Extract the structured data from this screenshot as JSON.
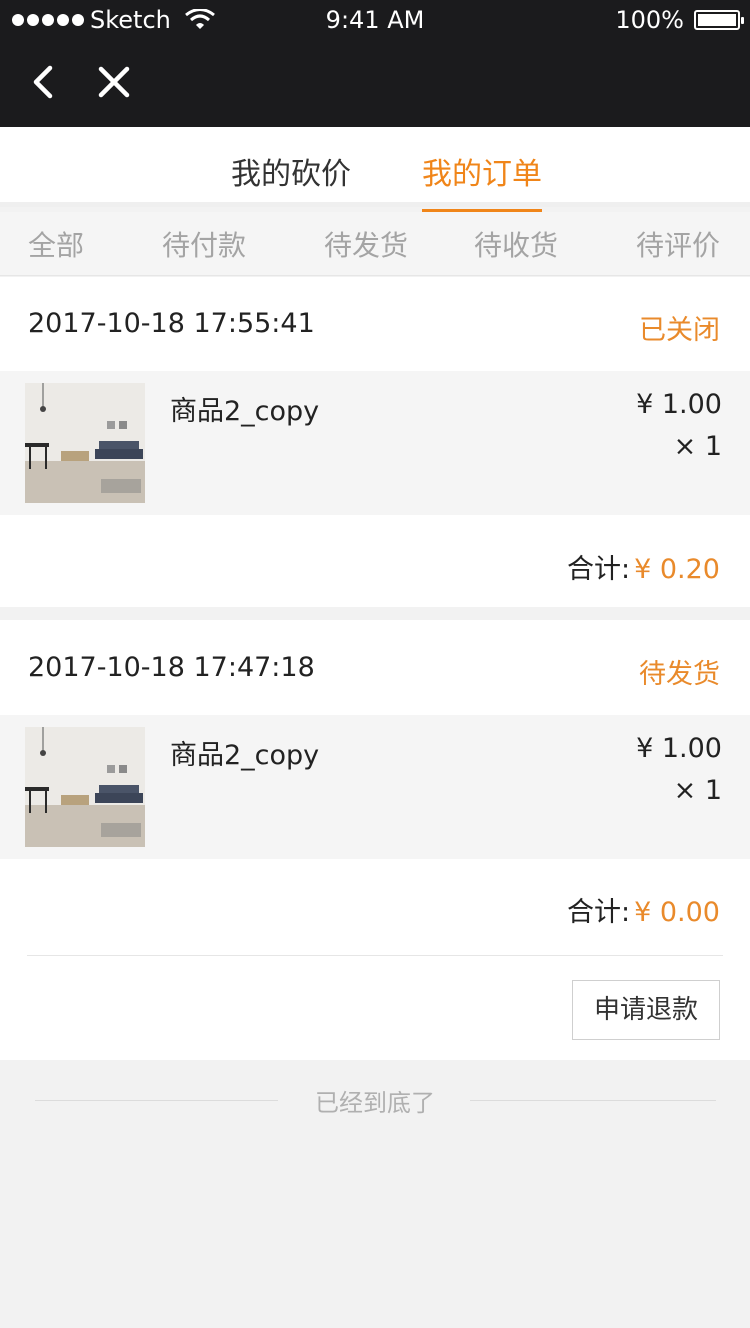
{
  "status_bar": {
    "carrier": "Sketch",
    "time": "9:41 AM",
    "battery": "100%"
  },
  "nav": {
    "back_icon": "chevron-left-icon",
    "close_icon": "close-icon"
  },
  "top_tabs": [
    {
      "label": "我的砍价",
      "active": false
    },
    {
      "label": "我的订单",
      "active": true
    }
  ],
  "sub_tabs": [
    "全部",
    "待付款",
    "待发货",
    "待收货",
    "待评价"
  ],
  "orders": [
    {
      "time": "2017-10-18 17:55:41",
      "status": "已关闭",
      "item": {
        "name": "商品2_copy",
        "price": "¥ 1.00",
        "qty": "× 1"
      },
      "total_label": "合计:",
      "total_value": "¥ 0.20"
    },
    {
      "time": "2017-10-18 17:47:18",
      "status": "待发货",
      "item": {
        "name": "商品2_copy",
        "price": "¥ 1.00",
        "qty": "× 1"
      },
      "total_label": "合计:",
      "total_value": "¥ 0.00",
      "action": "申请退款"
    }
  ],
  "footer": {
    "end_text": "已经到底了"
  },
  "colors": {
    "accent": "#f08519",
    "status": "#e98a2b",
    "dark_bar": "#1b1b1d"
  }
}
